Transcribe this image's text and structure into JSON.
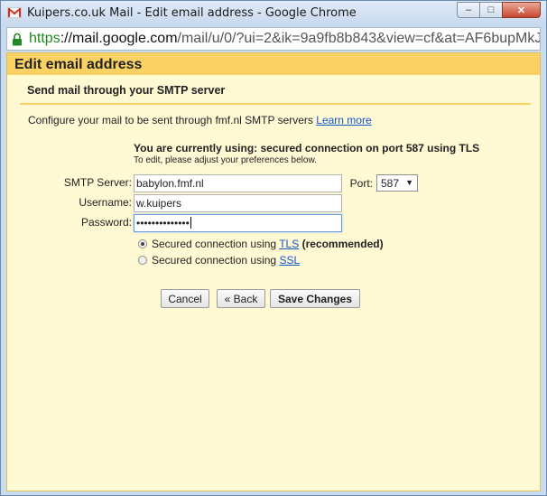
{
  "window": {
    "title": "Kuipers.co.uk Mail - Edit email address - Google Chrome",
    "controls": {
      "minimize": "–",
      "maximize": "□",
      "close": "✕"
    }
  },
  "address_bar": {
    "scheme": "https",
    "host_prefix": "://mail.google.com",
    "path": "/mail/u/0/?ui=2&ik=9a9fb8b843&view=cf&at=AF6bupMkJ"
  },
  "dialog": {
    "title": "Edit email address",
    "section_title": "Send mail through your SMTP server",
    "description": "Configure your mail to be sent through fmf.nl SMTP servers",
    "learn_more": "Learn more",
    "current_status": "You are currently using: secured connection on port 587 using TLS",
    "edit_hint": "To edit, please adjust your preferences below.",
    "form": {
      "smtp_label": "SMTP Server:",
      "smtp_value": "babylon.fmf.nl",
      "port_label": "Port:",
      "port_value": "587",
      "username_label": "Username:",
      "username_value": "w.kuipers",
      "password_label": "Password:",
      "password_value": "••••••••••••••"
    },
    "options": {
      "tls_prefix": "Secured connection using",
      "tls_link": "TLS",
      "tls_suffix": "(recommended)",
      "ssl_prefix": "Secured connection using",
      "ssl_link": "SSL",
      "selected": "TLS"
    },
    "buttons": {
      "cancel": "Cancel",
      "back": "« Back",
      "save": "Save Changes"
    }
  },
  "colors": {
    "dialog_bg": "#fff9d4",
    "header_bg": "#fad163",
    "link": "#1155cc",
    "secure_green": "#1f8a1f"
  }
}
